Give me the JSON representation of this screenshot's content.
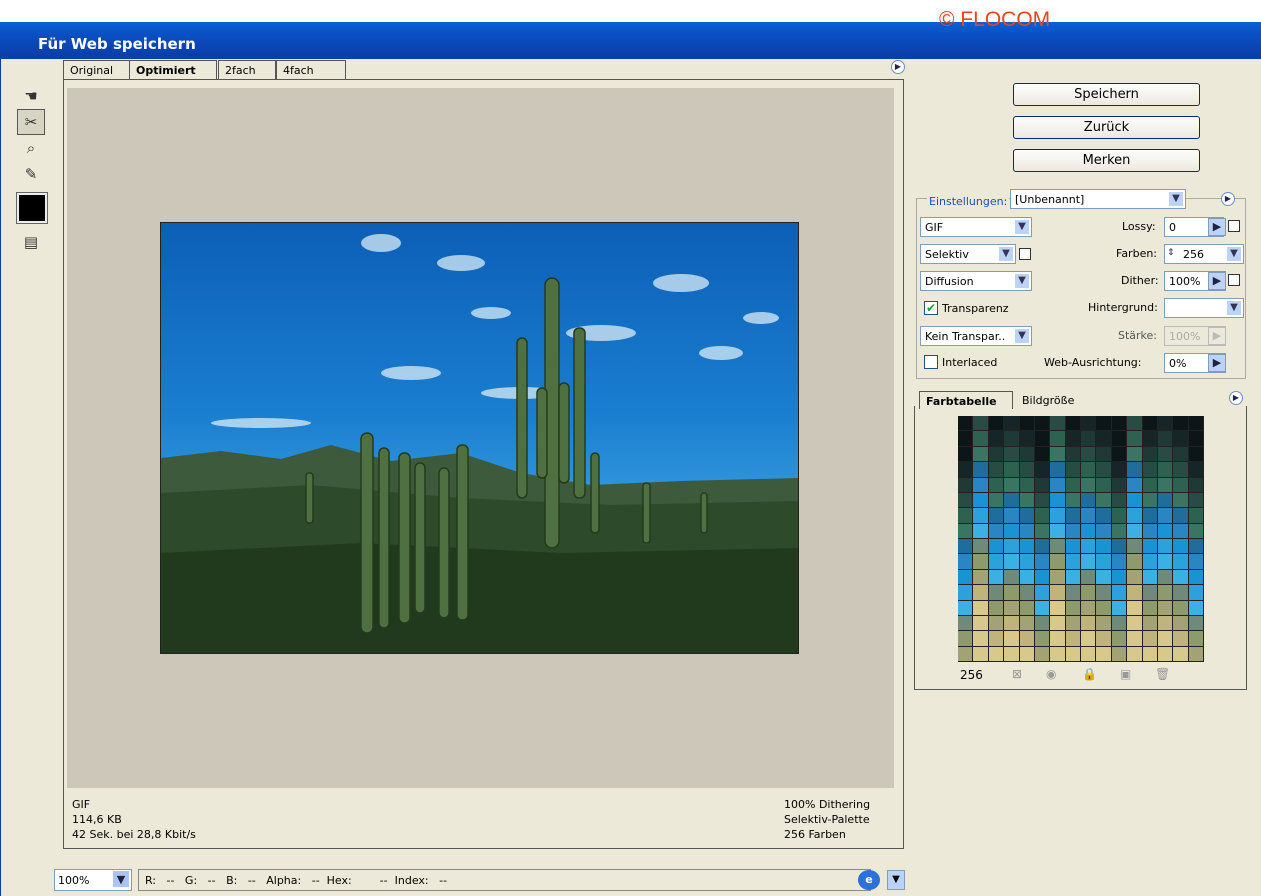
{
  "window": {
    "title": "Für Web speichern",
    "watermark": "© FLOCOM"
  },
  "tabs": [
    {
      "label": "Original"
    },
    {
      "label": "Optimiert",
      "active": true
    },
    {
      "label": "2fach"
    },
    {
      "label": "4fach"
    }
  ],
  "tools": [
    {
      "icon": "hand-icon",
      "glyph": "☚"
    },
    {
      "icon": "slice-select-icon",
      "glyph": "✂"
    },
    {
      "icon": "zoom-icon",
      "glyph": "🔍"
    },
    {
      "icon": "eyedropper-icon",
      "glyph": "✎"
    },
    {
      "icon": "preview-browser-icon",
      "glyph": "▤"
    }
  ],
  "info": {
    "left": [
      "GIF",
      "114,6 KB",
      "42 Sek. bei 28,8 Kbit/s"
    ],
    "right": [
      "100% Dithering",
      "Selektiv-Palette",
      "256 Farben"
    ]
  },
  "statusbar": {
    "zoom": "100%",
    "info": "R:   --   G:   --   B:   --   Alpha:   --  Hex:        --  Index:   --"
  },
  "buttons": {
    "save": "Speichern",
    "back": "Zurück",
    "remember": "Merken"
  },
  "settings": {
    "label": "Einstellungen:",
    "preset": "[Unbenannt]",
    "format": "GIF",
    "reduction": "Selektiv",
    "dither_algo": "Diffusion",
    "transparency_label": "Transparenz",
    "transparency_checked": true,
    "matte_dither": "Kein Transpar..",
    "interlaced_label": "Interlaced",
    "interlaced_checked": false,
    "lossy_label": "Lossy:",
    "lossy_value": "0",
    "colors_label": "Farben:",
    "colors_value": "256",
    "dither_label": "Dither:",
    "dither_value": "100%",
    "matte_label": "Hintergrund:",
    "matte_value": "",
    "amount_label": "Stärke:",
    "amount_value": "100%",
    "websnap_label": "Web-Ausrichtung:",
    "websnap_value": "0%"
  },
  "palette": {
    "tab_active": "Farbtabelle",
    "tab_inactive": "Bildgröße",
    "count": "256",
    "colors": [
      "#0c1618",
      "#162628",
      "#1f3a36",
      "#284c44",
      "#2e6250",
      "#3a7462",
      "#1f6d9a",
      "#2a86c2",
      "#1a93d4",
      "#2ba2dc",
      "#3cb0e2",
      "#6f8a7a",
      "#8c9a6c",
      "#a3a274",
      "#c1b47a",
      "#d8c98a"
    ]
  }
}
